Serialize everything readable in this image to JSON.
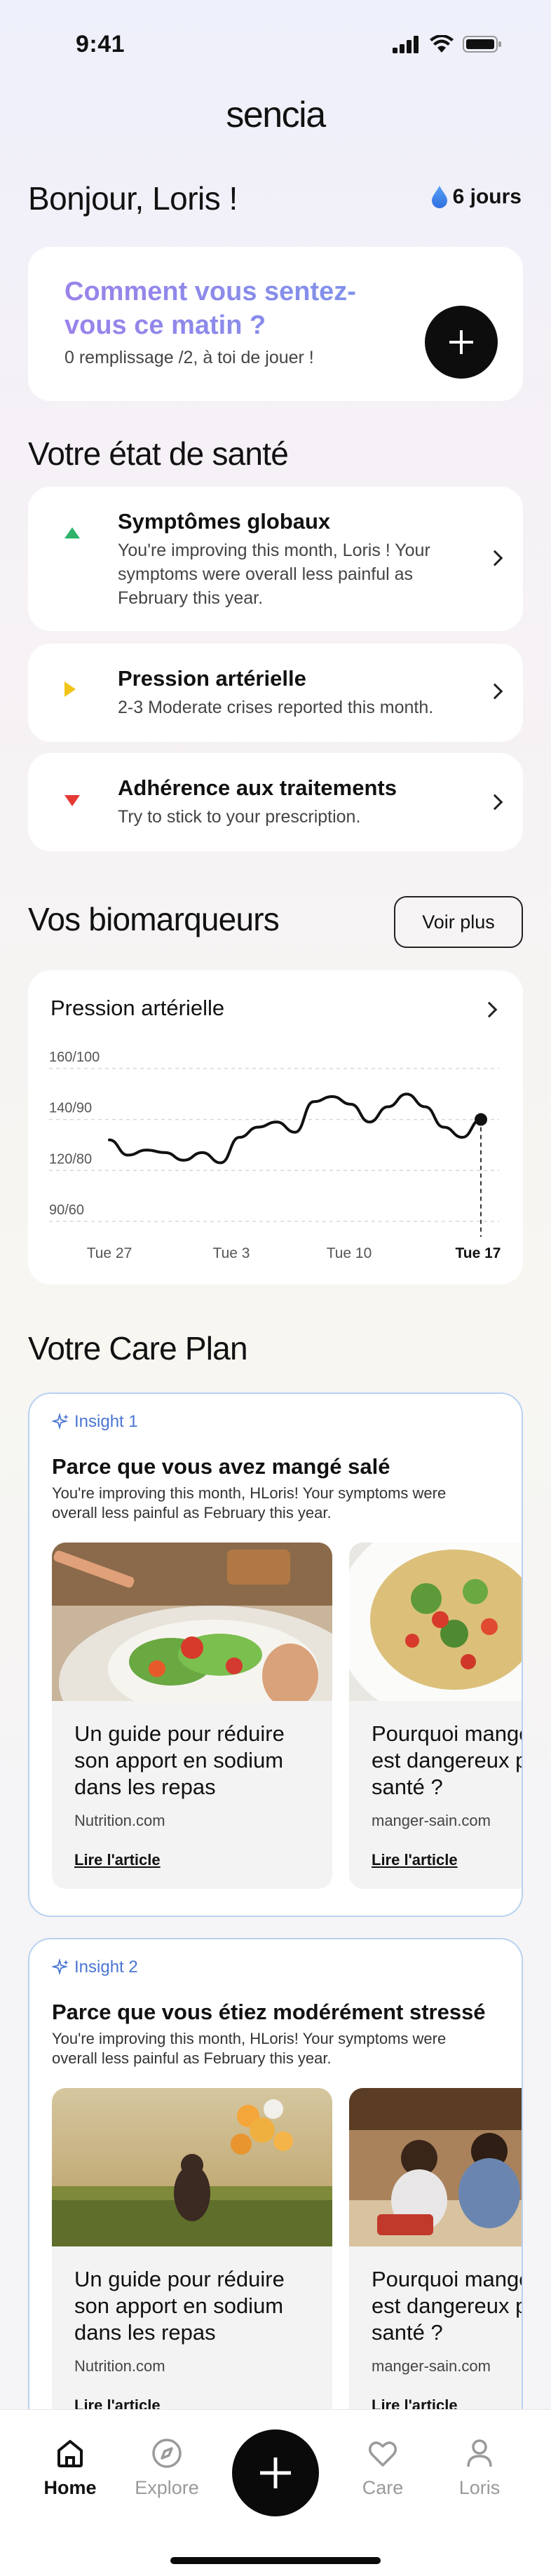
{
  "status_bar": {
    "time": "9:41"
  },
  "app": {
    "logo": "sencia"
  },
  "header": {
    "greeting": "Bonjour, Loris !",
    "streak": "6 jours",
    "streak_icon": "drop-icon"
  },
  "mood_card": {
    "title": "Comment vous sentez-vous ce matin ?",
    "subtitle": "0 remplissage /2, à toi de jouer !",
    "button_icon": "plus-icon"
  },
  "health": {
    "title": "Votre état de santé",
    "items": [
      {
        "title": "Symptômes globaux",
        "subtitle": "You're improving this month, Loris ! Your symptoms were overall less painful as February this year.",
        "trend": "up",
        "color": "#2fb36b"
      },
      {
        "title": "Pression artérielle",
        "subtitle": "2-3 Moderate crises reported this month.",
        "trend": "right",
        "color": "#f2c417"
      },
      {
        "title": "Adhérence aux traitements",
        "subtitle": "Try to stick to your prescription.",
        "trend": "down",
        "color": "#e53935"
      }
    ]
  },
  "biomarkers": {
    "title": "Vos biomarqueurs",
    "see_more": "Voir plus",
    "card_title": "Pression artérielle"
  },
  "chart_data": {
    "type": "line",
    "title": "Pression artérielle",
    "y_tick_labels": [
      "160/100",
      "140/90",
      "120/80",
      "90/60"
    ],
    "y_ticks": [
      160,
      140,
      120,
      90
    ],
    "ylim": [
      90,
      160
    ],
    "x_tick_labels": [
      "Tue 27",
      "Tue 3",
      "Tue 10",
      "Tue 17"
    ],
    "highlighted_x": "Tue 17",
    "grid": true,
    "series": [
      {
        "values": [
          132,
          126,
          128,
          127,
          124,
          127,
          123,
          133,
          137,
          139,
          135,
          147,
          149,
          146,
          139,
          145,
          150,
          145,
          137,
          133,
          140
        ]
      }
    ]
  },
  "care_plan": {
    "title": "Votre Care Plan",
    "insights": [
      {
        "label": "Insight 1",
        "title": "Parce que vous avez mangé salé",
        "subtitle": "You're improving this month, HLoris! Your symptoms were overall less painful as February this year.",
        "articles": [
          {
            "title": "Un guide pour réduire son apport en sodium dans les repas",
            "source": "Nutrition.com",
            "link": "Lire l'article",
            "image": "salad-photo"
          },
          {
            "title": "Pourquoi manger salé est dangereux pour la santé ?",
            "source": "manger-sain.com",
            "link": "Lire l'article",
            "image": "pasta-photo"
          }
        ]
      },
      {
        "label": "Insight 2",
        "title": "Parce que vous étiez modérément stressé",
        "subtitle": "You're improving this month, HLoris! Your symptoms were overall less painful as February this year.",
        "articles": [
          {
            "title": "Un guide pour réduire son apport en sodium dans les repas",
            "source": "Nutrition.com",
            "link": "Lire l'article",
            "image": "balloons-field-photo"
          },
          {
            "title": "Pourquoi manger salé est dangereux pour la santé ?",
            "source": "manger-sain.com",
            "link": "Lire l'article",
            "image": "family-kitchen-photo"
          }
        ]
      }
    ]
  },
  "tabbar": {
    "tabs": [
      {
        "label": "Home",
        "icon": "home-icon",
        "active": true
      },
      {
        "label": "Explore",
        "icon": "compass-icon",
        "active": false
      },
      {
        "label": "Care",
        "icon": "heart-icon",
        "active": false
      },
      {
        "label": "Loris",
        "icon": "user-icon",
        "active": false
      }
    ],
    "fab_icon": "plus-icon"
  }
}
